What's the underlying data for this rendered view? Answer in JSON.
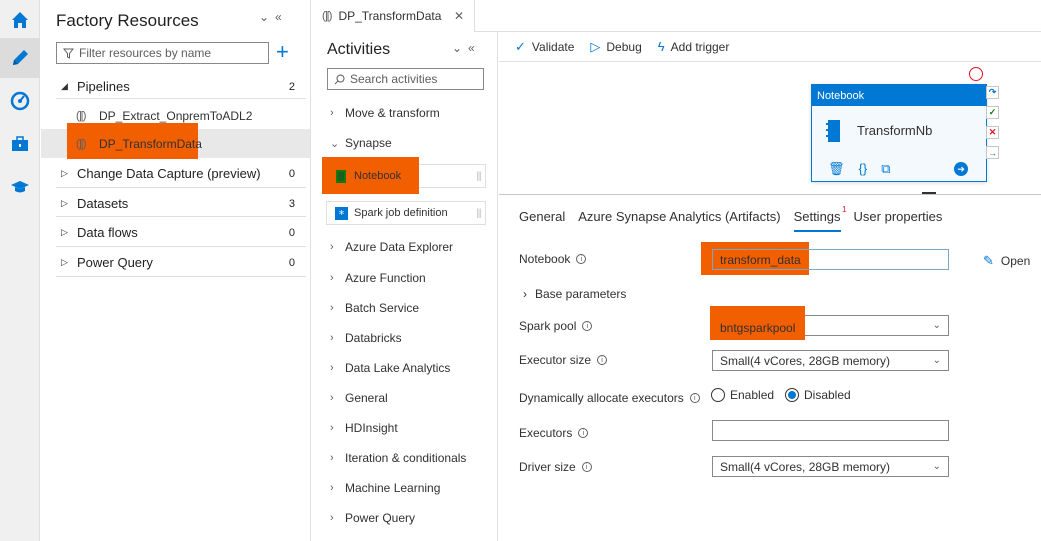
{
  "rail": {
    "items": [
      "home-icon",
      "pencil-icon",
      "monitor-icon",
      "toolbox-icon",
      "graduation-cap-icon"
    ]
  },
  "resources": {
    "title": "Factory Resources",
    "filter_placeholder": "Filter resources by name",
    "tree": [
      {
        "label": "Pipelines",
        "count": "2",
        "expanded": true
      },
      {
        "label": "DP_Extract_OnpremToADL2",
        "child": true
      },
      {
        "label": "DP_TransformData",
        "child": true,
        "selected": true
      },
      {
        "label": "Change Data Capture (preview)",
        "count": "0"
      },
      {
        "label": "Datasets",
        "count": "3"
      },
      {
        "label": "Data flows",
        "count": "0"
      },
      {
        "label": "Power Query",
        "count": "0"
      }
    ]
  },
  "tab": {
    "label": "DP_TransformData"
  },
  "activities": {
    "title": "Activities",
    "search_placeholder": "Search activities",
    "categories": {
      "move": "Move & transform",
      "synapse": "Synapse",
      "notebook": "Notebook",
      "spark": "Spark job definition",
      "ade": "Azure Data Explorer",
      "func": "Azure Function",
      "batch": "Batch Service",
      "databricks": "Databricks",
      "dla": "Data Lake Analytics",
      "general": "General",
      "hdi": "HDInsight",
      "iter": "Iteration & conditionals",
      "ml": "Machine Learning",
      "pq": "Power Query"
    }
  },
  "toolbar": {
    "validate": "Validate",
    "debug": "Debug",
    "trigger": "Add trigger"
  },
  "node": {
    "type": "Notebook",
    "name": "TransformNb"
  },
  "props": {
    "tabs": {
      "general": "General",
      "artifacts": "Azure Synapse Analytics (Artifacts)",
      "settings": "Settings",
      "settings_badge": "1",
      "user": "User properties"
    },
    "notebook_label": "Notebook",
    "notebook_value": "transform_data",
    "open_label": "Open",
    "base_params": "Base parameters",
    "spark_pool_label": "Spark pool",
    "spark_pool_value": "bntgsparkpool",
    "executor_size_label": "Executor size",
    "executor_size_value": "Small(4 vCores, 28GB memory)",
    "dyn_label": "Dynamically allocate executors",
    "enabled": "Enabled",
    "disabled": "Disabled",
    "executors_label": "Executors",
    "executors_value": "",
    "driver_size_label": "Driver size",
    "driver_size_value": "Small(4 vCores, 28GB memory)"
  },
  "colors": {
    "accent": "#0078d4",
    "highlight": "#f25f00"
  }
}
